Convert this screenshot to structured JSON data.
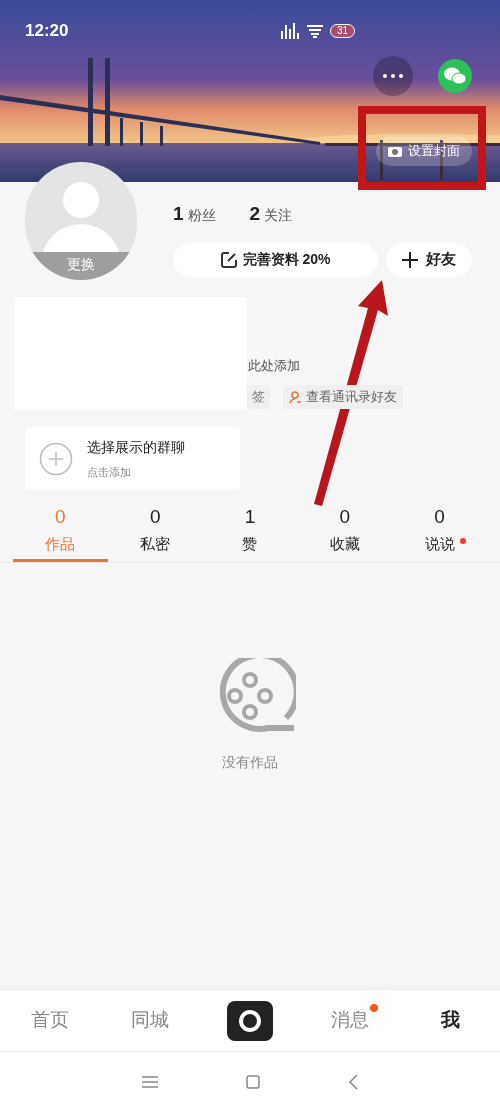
{
  "status_bar": {
    "time": "12:20",
    "battery": "31"
  },
  "cover": {
    "kind": "picture",
    "set_cover_button": "设置封面"
  },
  "avatar": {
    "change_label": "更换"
  },
  "stats": [
    {
      "value": "1",
      "label": "粉丝"
    },
    {
      "value": "2",
      "label": "关注"
    }
  ],
  "complete_profile_button": "完善资料 20%",
  "add_friend_button": "好友",
  "bio_hint": "此处添加",
  "tag_chip": "签",
  "contacts_chip": "查看通讯录好友",
  "group_card": {
    "title": "选择展示的群聊",
    "subtitle": "点击添加"
  },
  "tabs": [
    {
      "count": "0",
      "label": "作品",
      "selected": true,
      "badge": false
    },
    {
      "count": "0",
      "label": "私密",
      "selected": false,
      "badge": false
    },
    {
      "count": "1",
      "label": "赞",
      "selected": false,
      "badge": false
    },
    {
      "count": "0",
      "label": "收藏",
      "selected": false,
      "badge": false
    },
    {
      "count": "0",
      "label": "说说",
      "selected": false,
      "badge": true
    }
  ],
  "empty_state": "没有作品",
  "bottom_nav": [
    {
      "kind": "tab",
      "label": "首页",
      "selected": false,
      "badge": false
    },
    {
      "kind": "tab",
      "label": "同城",
      "selected": false,
      "badge": false
    },
    {
      "kind": "camera"
    },
    {
      "kind": "tab",
      "label": "消息",
      "selected": false,
      "badge": true
    },
    {
      "kind": "tab",
      "label": "我",
      "selected": true,
      "badge": false
    }
  ]
}
